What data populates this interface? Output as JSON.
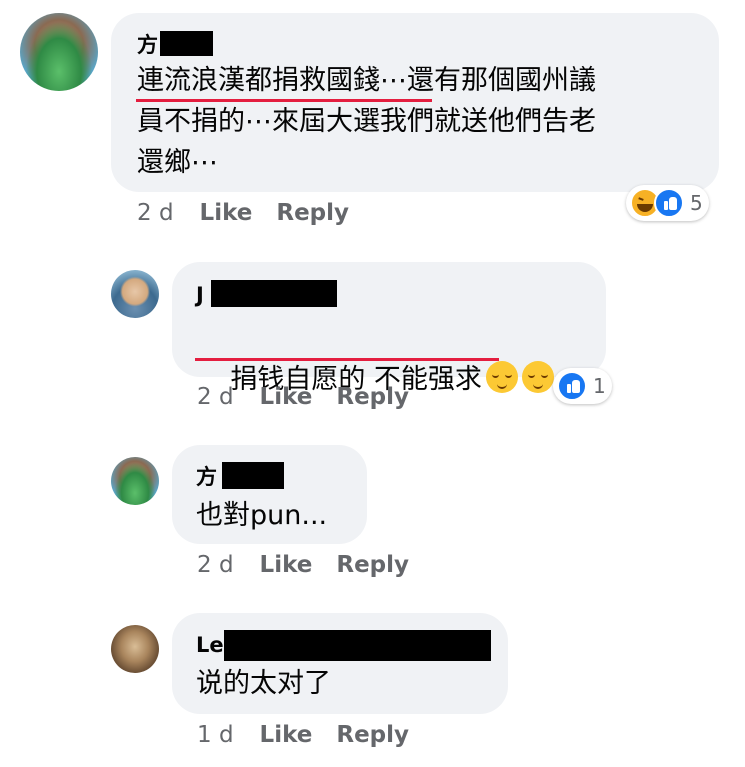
{
  "comments": [
    {
      "author_prefix": "方",
      "lines": [
        "連流浪漢都捐救國錢⋯還有那個國州議",
        "員不捐的⋯來屆大選我們就送他們告老",
        "還鄉⋯"
      ],
      "time": "2 d",
      "like_label": "Like",
      "reply_label": "Reply",
      "reaction_count": "5",
      "reactions": [
        "haha",
        "like"
      ]
    },
    {
      "author_prefix": "J",
      "text": "捐钱自愿的 不能强求",
      "emojis": [
        "relieved-face",
        "relieved-face"
      ],
      "time": "2 d",
      "like_label": "Like",
      "reply_label": "Reply",
      "reaction_count": "1",
      "reactions": [
        "like"
      ]
    },
    {
      "author_prefix": "方",
      "text": "也對pun...",
      "time": "2 d",
      "like_label": "Like",
      "reply_label": "Reply"
    },
    {
      "author_prefix": "Le",
      "text": "说的太对了",
      "time": "1 d",
      "like_label": "Like",
      "reply_label": "Reply"
    }
  ],
  "colors": {
    "bubble": "#f0f2f5",
    "underline": "#e41e3f",
    "meta_text": "#65676b",
    "like_blue": "#1877f2",
    "haha_yellow": "#f7b125"
  }
}
